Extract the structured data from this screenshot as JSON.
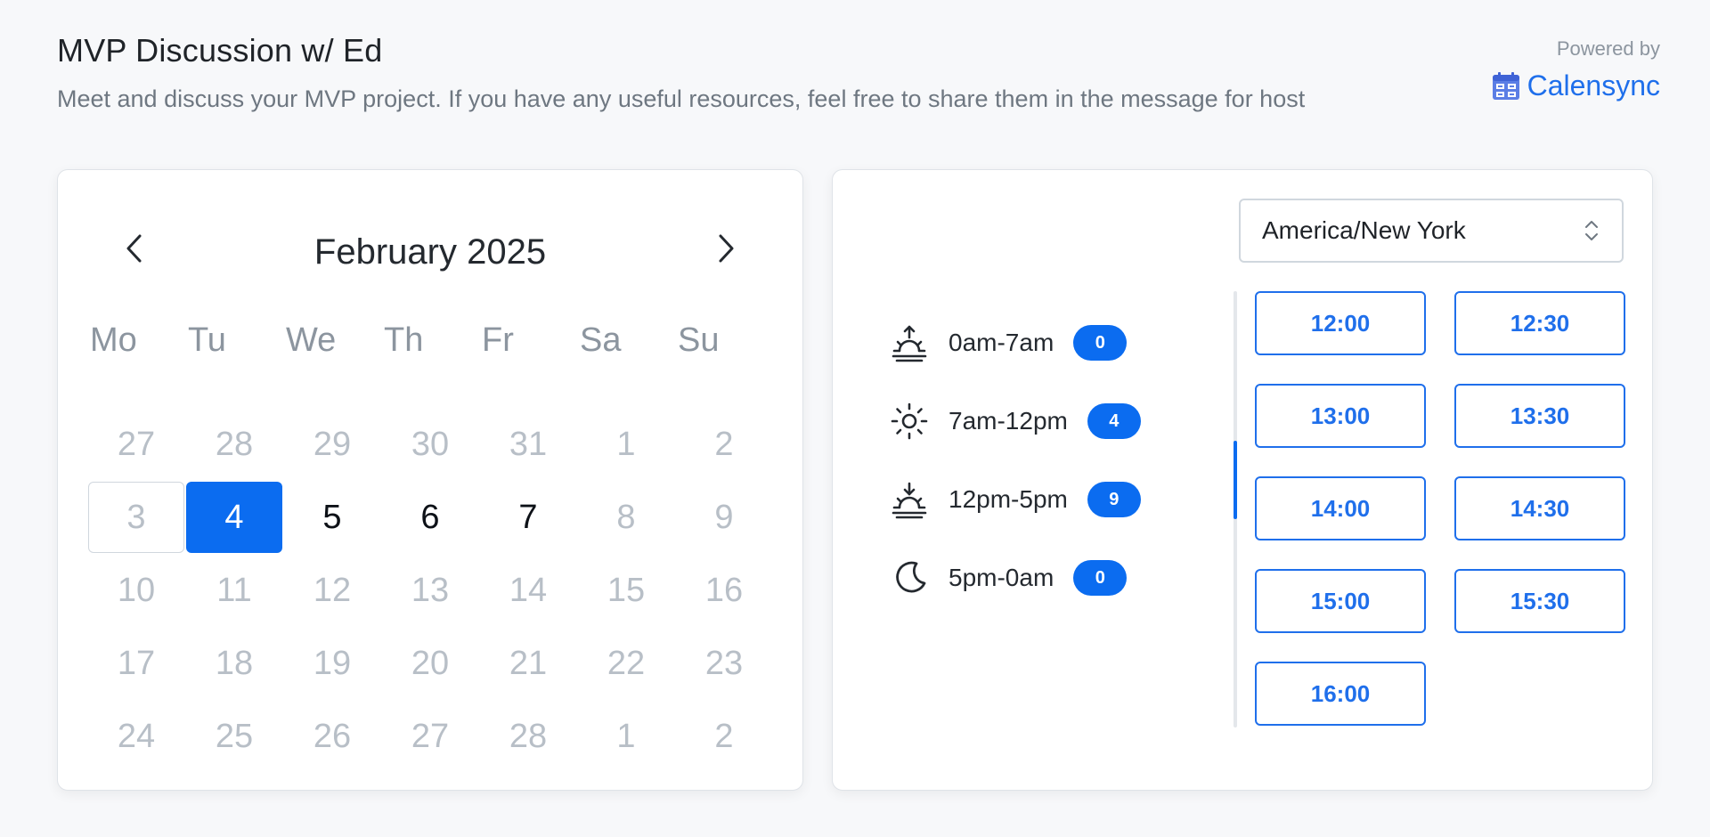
{
  "header": {
    "title": "MVP Discussion w/ Ed",
    "description": "Meet and discuss your MVP project. If you have any useful resources, feel free to share them in the message for host",
    "powered_by": "Powered by",
    "brand": "Calensync",
    "brand_icon": "calendar-grid-icon",
    "accent_color": "#1f6feb"
  },
  "calendar": {
    "month_label": "February 2025",
    "prev_icon": "chevron-left-icon",
    "next_icon": "chevron-right-icon",
    "weekdays": [
      "Mo",
      "Tu",
      "We",
      "Th",
      "Fr",
      "Sa",
      "Su"
    ],
    "days": [
      {
        "label": "27",
        "state": "disabled"
      },
      {
        "label": "28",
        "state": "disabled"
      },
      {
        "label": "29",
        "state": "disabled"
      },
      {
        "label": "30",
        "state": "disabled"
      },
      {
        "label": "31",
        "state": "disabled"
      },
      {
        "label": "1",
        "state": "disabled"
      },
      {
        "label": "2",
        "state": "disabled"
      },
      {
        "label": "3",
        "state": "today"
      },
      {
        "label": "4",
        "state": "selected"
      },
      {
        "label": "5",
        "state": "available"
      },
      {
        "label": "6",
        "state": "available"
      },
      {
        "label": "7",
        "state": "available"
      },
      {
        "label": "8",
        "state": "disabled"
      },
      {
        "label": "9",
        "state": "disabled"
      },
      {
        "label": "10",
        "state": "disabled"
      },
      {
        "label": "11",
        "state": "disabled"
      },
      {
        "label": "12",
        "state": "disabled"
      },
      {
        "label": "13",
        "state": "disabled"
      },
      {
        "label": "14",
        "state": "disabled"
      },
      {
        "label": "15",
        "state": "disabled"
      },
      {
        "label": "16",
        "state": "disabled"
      },
      {
        "label": "17",
        "state": "disabled"
      },
      {
        "label": "18",
        "state": "disabled"
      },
      {
        "label": "19",
        "state": "disabled"
      },
      {
        "label": "20",
        "state": "disabled"
      },
      {
        "label": "21",
        "state": "disabled"
      },
      {
        "label": "22",
        "state": "disabled"
      },
      {
        "label": "23",
        "state": "disabled"
      },
      {
        "label": "24",
        "state": "disabled"
      },
      {
        "label": "25",
        "state": "disabled"
      },
      {
        "label": "26",
        "state": "disabled"
      },
      {
        "label": "27",
        "state": "disabled"
      },
      {
        "label": "28",
        "state": "disabled"
      },
      {
        "label": "1",
        "state": "disabled"
      },
      {
        "label": "2",
        "state": "disabled"
      }
    ],
    "selected_color": "#0b6cf0"
  },
  "timezone": {
    "value": "America/New York",
    "chevron_icon": "chevron-up-down-icon"
  },
  "periods": [
    {
      "icon": "sunrise-icon",
      "label": "0am-7am",
      "count": "0"
    },
    {
      "icon": "sun-icon",
      "label": "7am-12pm",
      "count": "4"
    },
    {
      "icon": "sunset-icon",
      "label": "12pm-5pm",
      "count": "9"
    },
    {
      "icon": "moon-icon",
      "label": "5pm-0am",
      "count": "0"
    }
  ],
  "slots": [
    "12:00",
    "12:30",
    "13:00",
    "13:30",
    "14:00",
    "14:30",
    "15:00",
    "15:30",
    "16:00"
  ]
}
